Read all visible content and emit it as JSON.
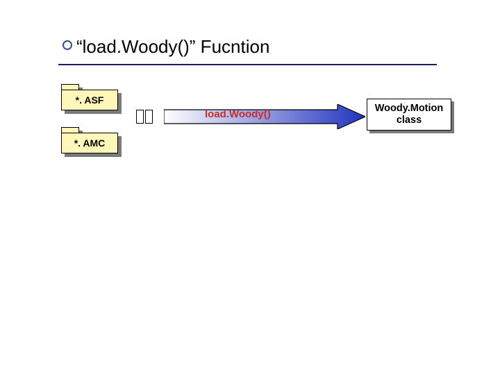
{
  "title": "“load.Woody()” Fucntion",
  "folders": {
    "asf": "*. ASF",
    "amc": "*. AMC"
  },
  "arrow_label": "load.Woody()",
  "class_box": "Woody.Motion\nclass",
  "colors": {
    "folder_fill": "#fef7b9",
    "title_rule": "#1a1f5c",
    "arrow_label": "#c62c2c",
    "arrow_gradient_from": "#ffffff",
    "arrow_gradient_to": "#2234c0"
  }
}
